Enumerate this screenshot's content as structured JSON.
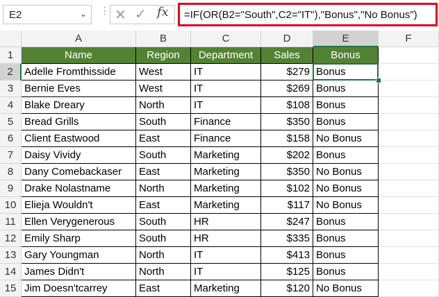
{
  "namebox": {
    "value": "E2"
  },
  "formula": {
    "text": "=IF(OR(B2=\"South\",C2=\"IT\"),\"Bonus\",\"No Bonus\")"
  },
  "columns": [
    "A",
    "B",
    "C",
    "D",
    "E",
    "F"
  ],
  "headers": [
    "Name",
    "Region",
    "Department",
    "Sales",
    "Bonus"
  ],
  "rows": [
    [
      "Adelle Fromthisside",
      "West",
      "IT",
      "$279",
      "Bonus"
    ],
    [
      "Bernie Eves",
      "West",
      "IT",
      "$269",
      "Bonus"
    ],
    [
      "Blake Dreary",
      "North",
      "IT",
      "$108",
      "Bonus"
    ],
    [
      "Bread Grills",
      "South",
      "Finance",
      "$350",
      "Bonus"
    ],
    [
      "Client Eastwood",
      "East",
      "Finance",
      "$158",
      "No Bonus"
    ],
    [
      "Daisy Vividy",
      "South",
      "Marketing",
      "$202",
      "Bonus"
    ],
    [
      "Dany Comebackaser",
      "East",
      "Marketing",
      "$350",
      "No Bonus"
    ],
    [
      "Drake Nolastname",
      "North",
      "Marketing",
      "$102",
      "No Bonus"
    ],
    [
      "Elieja Wouldn't",
      "East",
      "Marketing",
      "$117",
      "No Bonus"
    ],
    [
      "Ellen Verygenerous",
      "South",
      "HR",
      "$247",
      "Bonus"
    ],
    [
      "Emily Sharp",
      "South",
      "HR",
      "$335",
      "Bonus"
    ],
    [
      "Gary Youngman",
      "North",
      "IT",
      "$413",
      "Bonus"
    ],
    [
      "James Didn't",
      "North",
      "IT",
      "$125",
      "Bonus"
    ],
    [
      "Jim Doesn'tcarrey",
      "East",
      "Marketing",
      "$120",
      "No Bonus"
    ]
  ],
  "selected": {
    "col": "E",
    "row": 2
  },
  "colors": {
    "header_fill": "#548235",
    "selection": "#217346",
    "formula_highlight": "#e0001b"
  }
}
